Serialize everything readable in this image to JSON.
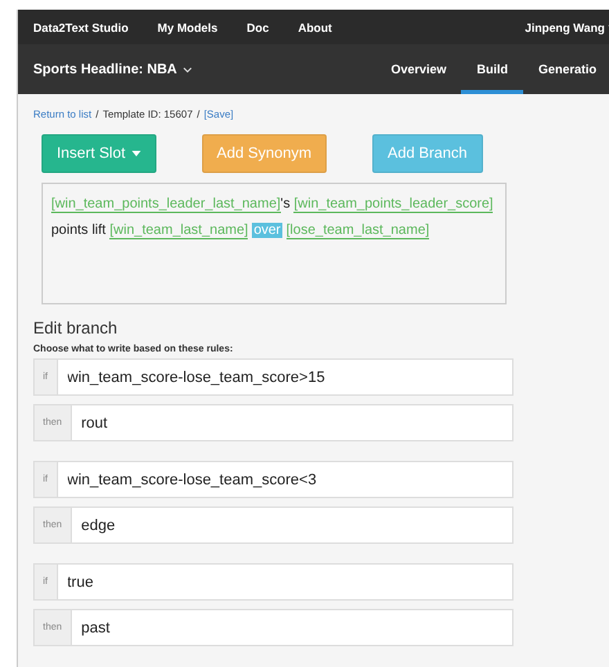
{
  "top_nav": {
    "items": [
      {
        "label": "Data2Text Studio"
      },
      {
        "label": "My Models"
      },
      {
        "label": "Doc"
      },
      {
        "label": "About"
      }
    ],
    "user": "Jinpeng Wang"
  },
  "sub_nav": {
    "title": "Sports Headline: NBA",
    "tabs": [
      {
        "label": "Overview",
        "selected": false
      },
      {
        "label": "Build",
        "selected": true
      },
      {
        "label": "Generatio",
        "selected": false
      }
    ]
  },
  "breadcrumb": {
    "link": "Return to list",
    "separator_1": "/",
    "template_id": "Template ID: 15607",
    "separator_2": "/",
    "save": "[Save]"
  },
  "buttons": [
    {
      "label": "Insert Slot",
      "kind": "green",
      "dropdown": true
    },
    {
      "label": "Add Synonym",
      "kind": "orange",
      "dropdown": false
    },
    {
      "label": "Add Branch",
      "kind": "blue",
      "dropdown": false
    }
  ],
  "template": [
    {
      "kind": "slot",
      "text": "[win_team_points_leader_last_name]"
    },
    {
      "kind": "text",
      "text": "'s "
    },
    {
      "kind": "slot",
      "text": "[win_team_points_leader_score]"
    },
    {
      "kind": "text",
      "text": " points lift "
    },
    {
      "kind": "slot",
      "text": "[win_team_last_name]"
    },
    {
      "kind": "highlight",
      "text": "over"
    },
    {
      "kind": "slot",
      "text": "[lose_team_last_name]"
    }
  ],
  "edit_branch": {
    "title": "Edit branch",
    "subtitle": "Choose what to write based on these rules:",
    "rules": [
      {
        "if_label": "if",
        "condition": "win_team_score-lose_team_score>15",
        "then_label": "then",
        "result": "rout"
      },
      {
        "if_label": "if",
        "condition": "win_team_score-lose_team_score<3",
        "then_label": "then",
        "result": "edge"
      },
      {
        "if_label": "if",
        "condition": "true",
        "then_label": "then",
        "result": "past"
      }
    ]
  }
}
